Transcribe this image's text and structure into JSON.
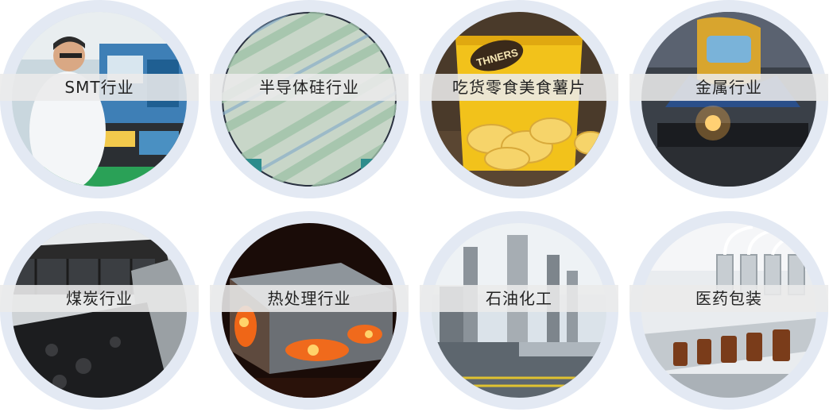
{
  "industries": [
    {
      "label": "SMT行业",
      "image": "smt-factory-worker"
    },
    {
      "label": "半导体硅行业",
      "image": "silicon-wafer"
    },
    {
      "label": "吃货零食美食薯片",
      "image": "potato-chips-bag"
    },
    {
      "label": "金属行业",
      "image": "metal-welding"
    },
    {
      "label": "煤炭行业",
      "image": "coal-rail-cars"
    },
    {
      "label": "热处理行业",
      "image": "hot-metal-block"
    },
    {
      "label": "石油化工",
      "image": "petrochemical-plant"
    },
    {
      "label": "医药包装",
      "image": "medicine-bottle-line"
    }
  ],
  "chip_bag_brand": "THNERS",
  "colors": {
    "ring": "#e3e9f3",
    "label_band": "#ebebeb",
    "label_text": "#222222"
  }
}
